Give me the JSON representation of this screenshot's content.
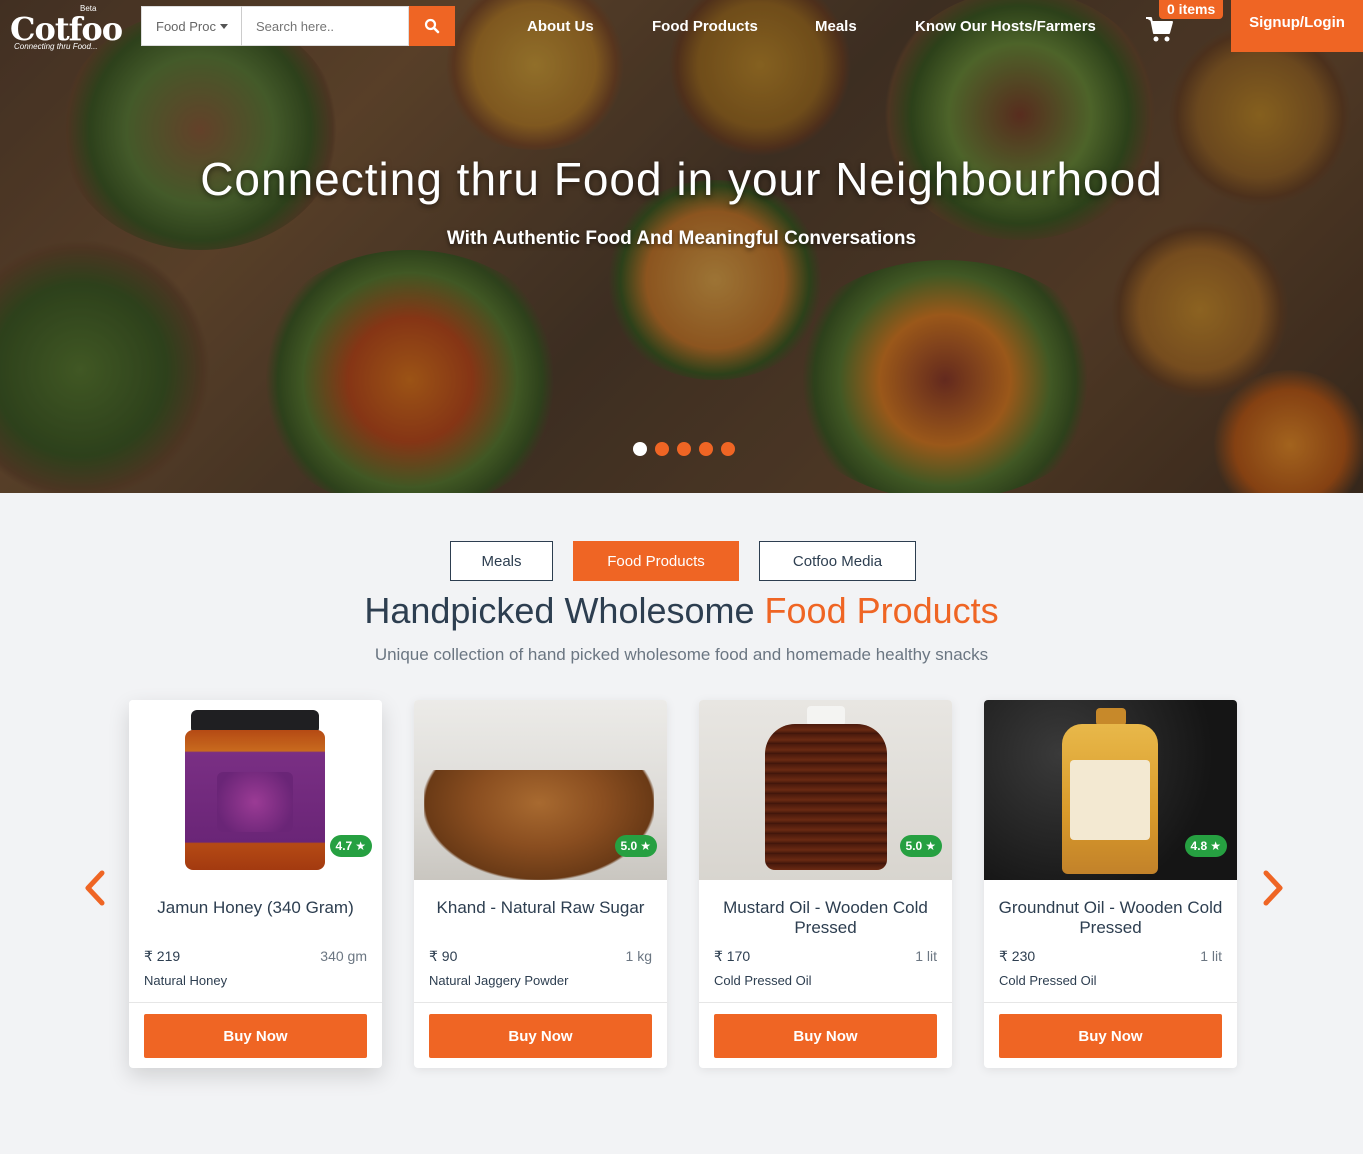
{
  "logo": {
    "name": "Cotfoo",
    "beta": "Beta",
    "tagline": "Connecting thru Food..."
  },
  "search": {
    "category": "Food Proc",
    "placeholder": "Search here.."
  },
  "nav": {
    "items": [
      "About Us",
      "Food Products",
      "Meals",
      "Know Our Hosts/Farmers"
    ]
  },
  "cart": {
    "badge": "0 items"
  },
  "signup": "Signup/Login",
  "hero": {
    "title": "Connecting thru Food in your Neighbourhood",
    "subtitle": "With Authentic Food And Meaningful Conversations",
    "slide_count": 5,
    "active_slide": 1
  },
  "tabs": {
    "items": [
      "Meals",
      "Food Products",
      "Cotfoo Media"
    ],
    "active": "Food Products"
  },
  "section": {
    "title_main": "Handpicked Wholesome",
    "title_accent": "Food Products",
    "subtitle": "Unique collection of hand picked wholesome food and homemade healthy snacks"
  },
  "products": [
    {
      "name": "Jamun Honey (340 Gram)",
      "price": "₹ 219",
      "qty": "340 gm",
      "category": "Natural Honey",
      "rating": "4.7",
      "buy": "Buy Now"
    },
    {
      "name": "Khand - Natural Raw Sugar",
      "price": "₹ 90",
      "qty": "1 kg",
      "category": "Natural Jaggery Powder",
      "rating": "5.0",
      "buy": "Buy Now"
    },
    {
      "name": "Mustard Oil - Wooden Cold Pressed",
      "price": "₹ 170",
      "qty": "1 lit",
      "category": "Cold Pressed Oil",
      "rating": "5.0",
      "buy": "Buy Now"
    },
    {
      "name": "Groundnut Oil - Wooden Cold Pressed",
      "price": "₹ 230",
      "qty": "1 lit",
      "category": "Cold Pressed Oil",
      "rating": "4.8",
      "buy": "Buy Now"
    }
  ],
  "colors": {
    "accent": "#ef6524",
    "navy": "#2d3e50",
    "rating": "#26a041"
  }
}
